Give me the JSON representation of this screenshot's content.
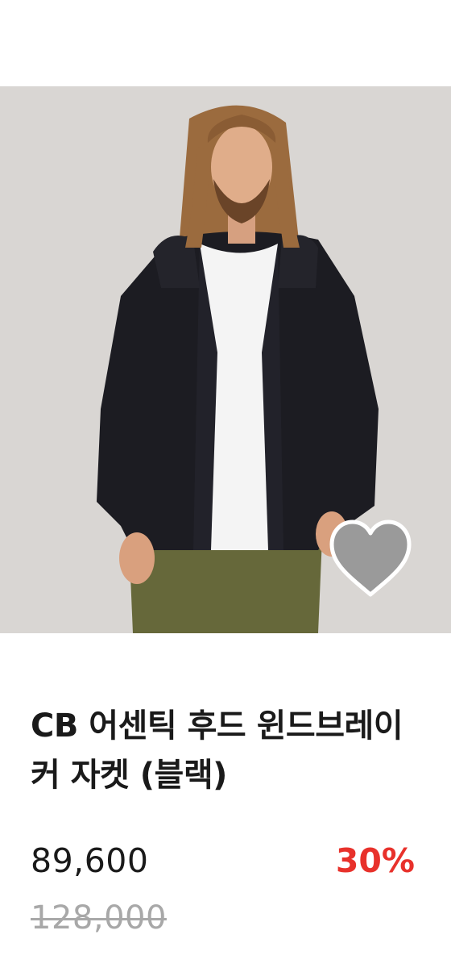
{
  "product": {
    "title": "CB 어센틱 후드 윈드브레이커 자켓 (블랙)",
    "price": "89,600",
    "discount": "30%",
    "original_price": "128,000"
  },
  "colors": {
    "discount": "#e8312b",
    "original_price": "#a8a8a8",
    "text": "#1a1a1a",
    "image_background": "#d9d6d3"
  },
  "icons": {
    "wishlist": "heart-icon"
  }
}
